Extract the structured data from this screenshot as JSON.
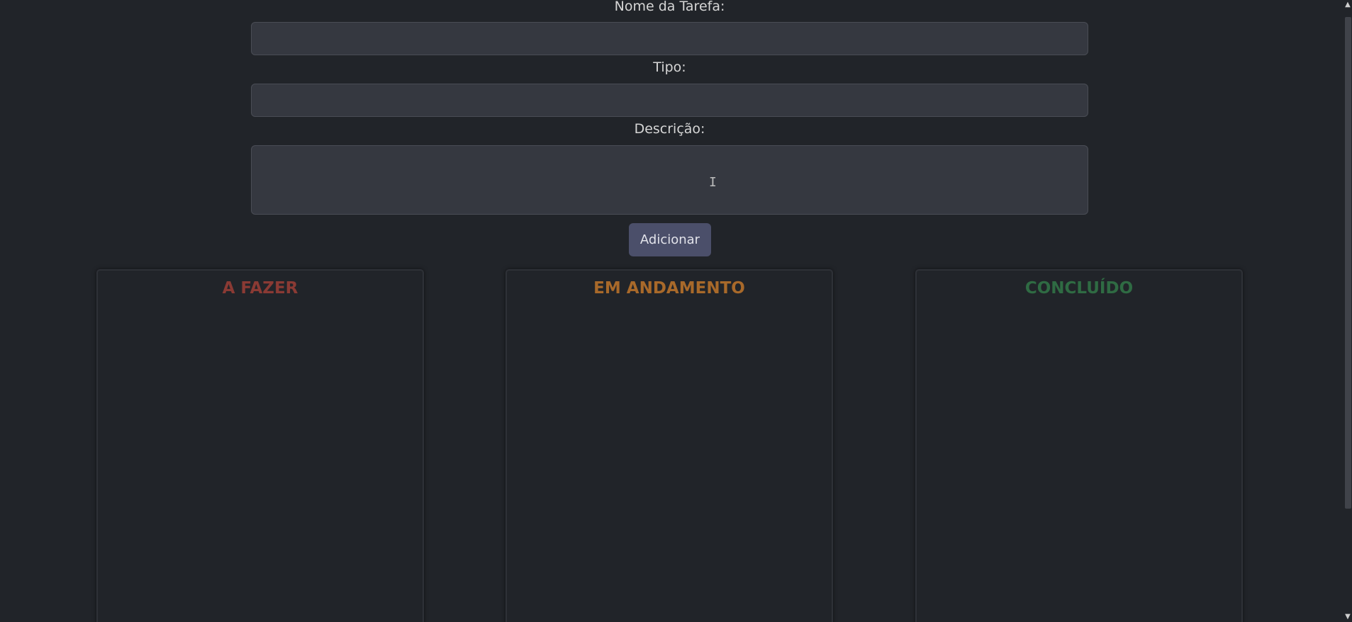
{
  "form": {
    "name_label": "Nome da Tarefa:",
    "name_value": "",
    "type_label": "Tipo:",
    "type_value": "",
    "description_label": "Descrição:",
    "description_value": "",
    "submit_label": "Adicionar"
  },
  "board": {
    "columns": [
      {
        "title": "A FAZER",
        "color": "#8a3a34"
      },
      {
        "title": "EM ANDAMENTO",
        "color": "#a8692a"
      },
      {
        "title": "CONCLUÍDO",
        "color": "#2f6b43"
      }
    ]
  },
  "cursor": {
    "icon": "text-cursor-icon",
    "glyph": "I"
  },
  "scrollbar": {
    "up_icon": "chevron-up-icon",
    "down_icon": "chevron-down-icon"
  }
}
